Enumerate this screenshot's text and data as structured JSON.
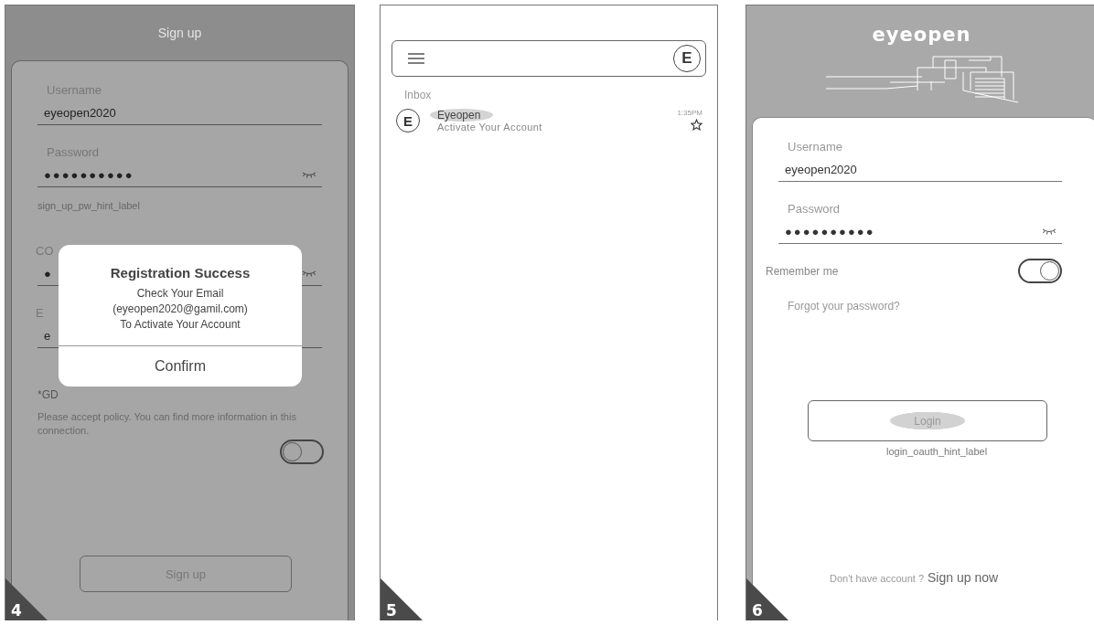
{
  "signup_screen": {
    "number": "4",
    "title": "Sign up",
    "fields": [
      {
        "label": "Username",
        "value": "eyeopen2020",
        "kind": "text"
      },
      {
        "label": "Password",
        "value": "●●●●●●●●●●",
        "kind": "password"
      }
    ],
    "hint": "sign_up_pw_hint_label",
    "covered_fields": [
      {
        "label": "CO",
        "value": "●",
        "kind": "password"
      },
      {
        "label": "E",
        "value": "e",
        "kind": "text"
      }
    ],
    "gdpr_label": "*GD",
    "policy": "Please accept policy.  You can find more information in this connection.",
    "policy_toggle": {
      "on": false
    },
    "button": "Sign up",
    "dialog": {
      "title": "Registration Success",
      "lines": [
        "Check Your Email",
        "(eyeopen2020@gamil.com)",
        "To Activate Your Account"
      ],
      "button": "Confirm"
    }
  },
  "inbox_screen": {
    "number": "5",
    "account_initial": "E",
    "folder": "Inbox",
    "messages": [
      {
        "avatar": "E",
        "sender": "Eyeopen",
        "subject": "Activate Your Account",
        "time": "1:35PM",
        "starred": false
      }
    ]
  },
  "login_screen": {
    "number": "6",
    "logo": "eyeopen",
    "fields": [
      {
        "label": "Username",
        "value": "eyeopen2020",
        "kind": "text"
      },
      {
        "label": "Password",
        "value": "●●●●●●●●●●",
        "kind": "password"
      }
    ],
    "remember": {
      "label": "Remember me",
      "on": true
    },
    "forgot": "Forgot your password?",
    "button": "Login",
    "hint": "login_oauth_hint_label",
    "signup_prompt": "Don't have account ?",
    "signup_link": "Sign up now"
  }
}
